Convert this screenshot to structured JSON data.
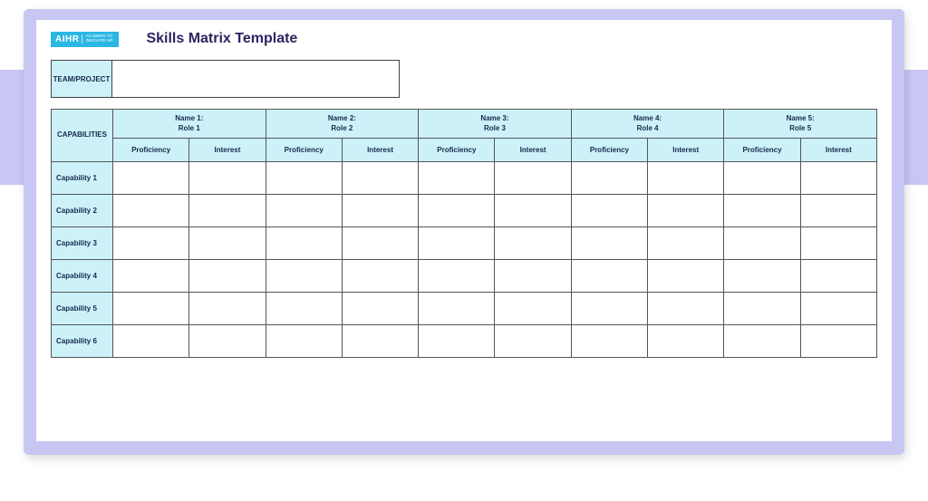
{
  "logo": {
    "main": "AIHR",
    "sub": "ACADEMY TO INNOVATE HR"
  },
  "title": "Skills Matrix Template",
  "team_label": "TEAM/PROJECT",
  "team_value": "",
  "cap_header": "CAPABILITIES",
  "sub_headers": {
    "proficiency": "Proficiency",
    "interest": "Interest"
  },
  "people": [
    {
      "name": "Name 1:",
      "role": "Role 1"
    },
    {
      "name": "Name 2:",
      "role": "Role 2"
    },
    {
      "name": "Name 3:",
      "role": "Role 3"
    },
    {
      "name": "Name 4:",
      "role": "Role 4"
    },
    {
      "name": "Name 5:",
      "role": "Role 5"
    }
  ],
  "capabilities": [
    "Capability 1",
    "Capability 2",
    "Capability 3",
    "Capability 4",
    "Capability 5",
    "Capability 6"
  ],
  "colors": {
    "accent_light": "#ccf1f9",
    "logo_bg": "#2bb7e4",
    "title": "#2b2560",
    "frame": "#c8c6f2"
  }
}
